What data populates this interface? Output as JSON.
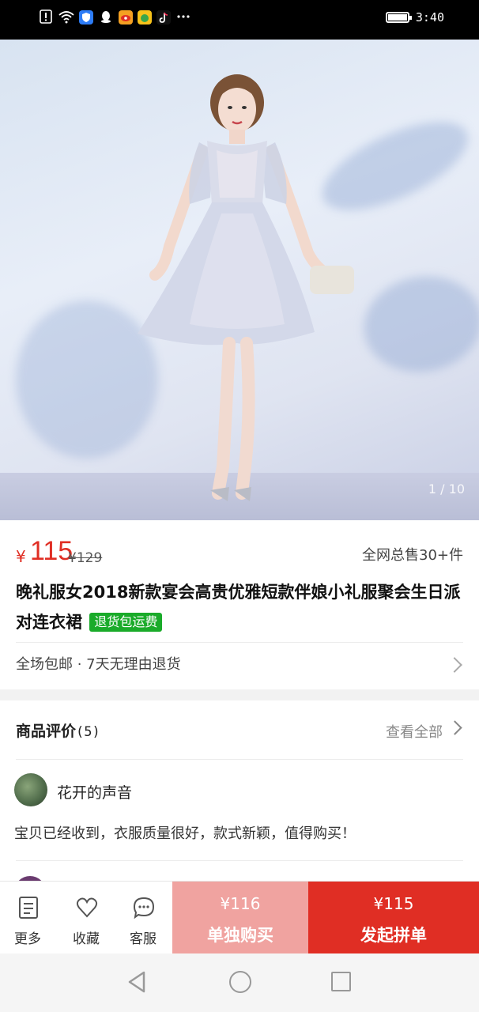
{
  "status_bar": {
    "time": "3:40",
    "icons": [
      "alert-icon",
      "wifi-icon",
      "shield-app-icon",
      "qq-icon",
      "weibo-icon",
      "money-app-icon",
      "tiktok-icon",
      "more-dots-icon",
      "battery-icon"
    ]
  },
  "gallery": {
    "counter": "1 / 10"
  },
  "product": {
    "currency": "¥",
    "price": "115",
    "original_price": "¥129",
    "sales": "全网总售30+件",
    "title": "晚礼服女2018新款宴会高贵优雅短款伴娘小礼服聚会生日派对连衣裙",
    "tag": "退货包运费",
    "tag_color": "#1aab2a"
  },
  "services": {
    "text": "全场包邮 · 7天无理由退货"
  },
  "reviews": {
    "title": "商品评价",
    "count": "(5)",
    "view_all": "查看全部",
    "items": [
      {
        "user": "花开的声音",
        "text": "宝贝已经收到，衣服质量很好，款式新颖，值得购买！"
      }
    ]
  },
  "bottom_bar": {
    "more": "更多",
    "favorite": "收藏",
    "service": "客服",
    "solo_price": "¥116",
    "solo_label": "单独购买",
    "group_price": "¥115",
    "group_label": "发起拼单",
    "accent_color": "#e02e24",
    "solo_color": "#f0a3a0"
  }
}
